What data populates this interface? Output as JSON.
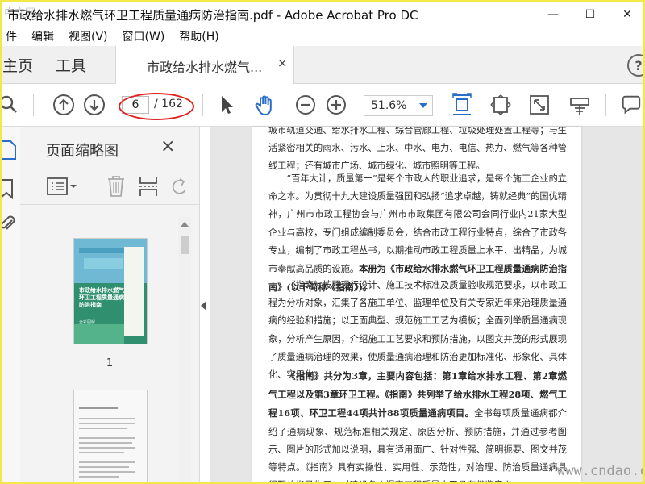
{
  "window": {
    "title": "市政给水排水燃气环卫工程质量通病防治指南.pdf - Adobe Acrobat Pro DC",
    "watermark_tl": "中文网",
    "min_glyph": "—",
    "max_glyph": "☐",
    "close_glyph": "✕"
  },
  "menu": [
    "件",
    "编辑",
    "视图(V)",
    "窗口(W)",
    "帮助(H)"
  ],
  "tabs": {
    "home": "主页",
    "tools": "工具",
    "doc": "市政给水排水燃气...",
    "close": "×",
    "help": "?"
  },
  "toolbar": {
    "current_page": "6",
    "total_pages": "/ 162",
    "zoom": "51.6%"
  },
  "thumbnails": {
    "title": "页面缩略图",
    "close": "×",
    "page1_label": "1",
    "cover_title": "市政给水排水燃气环卫工程质量通病防治指南",
    "cover_sub": "全彩图解"
  },
  "document": {
    "lines_p0": "城市轨道交通、给水排水工程、综合管廊工程、垃圾处理处置工程等；与生活紧密相关的雨水、污水、上水、中水、电力、电信、热力、燃气等各种管线工程；还有城市广场、城市绿化、城市照明等工程。",
    "p1": "“百年大计，质量第一”是每个市政人的职业追求，是每个施工企业的立命之本。为贯彻十九大建设质量强国和弘扬“追求卓越，铸就经典”的国优精神，广州市市政工程协会与广州市市政集团有限公司会同行业内21家大型企业与高校，专门组成编制委员会，结合市政工程行业特点，综合了市政各专业，编制了市政工程丛书，以期推动市政工程质量上水平、出精品，为城市奉献高品质的设施。",
    "p1_bold": "本册为《市政给水排水燃气环卫工程质量通病防治指南》(以下简称《指南》)。",
    "p2": "《指南》按照现行设计、施工技术标准及质量验收规范要求，以市政工程为分析对象，汇集了各施工单位、监理单位及有关专家近年来治理质量通病的经验和措施；以正面典型、规范施工工艺为模板；全面列举质量通病现象，分析产生原因，介绍施工工艺要求和预防措施，以图文并茂的形式展现了质量通病治理的效果，使质量通病治理和防治更加标准化、形象化、具体化、实用化。",
    "p3_bold": "《指南》共分为3章，主要内容包括：第1章给水排水工程、第2章燃气工程以及第3章环卫工程。《指南》共列举了给水排水工程28项、燃气工程16项、环卫工程44项共计88项质量通病项目。",
    "p3": "全书每项质量通病都介绍了通病现象、规范标准相关规定、原因分析、预防措施，并通过参考图示、图片的形式加以说明，具有适用面广、针对性强、简明扼要、图文并茂等特点。《指南》具有实操性、实用性、示范性，对治理、防治质量通病具很强的指导作用，对建设各方提高工程质量水平具有借鉴意义。"
  },
  "watermark": "www.cndao.com",
  "colors": {
    "accent": "#2a6dc9",
    "highlight_ellipse": "#e0201c",
    "frame": "#f3e84a"
  }
}
